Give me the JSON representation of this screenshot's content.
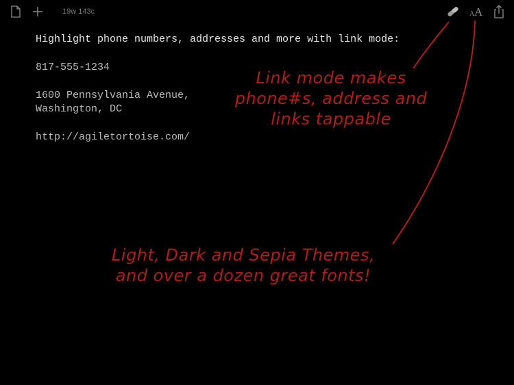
{
  "toolbar": {
    "word_count": "19w 143c",
    "icons": {
      "documents": "document-icon",
      "new": "plus-icon",
      "link_mode": "link-icon",
      "font": "font-size-icon",
      "share": "share-icon"
    },
    "font_label_small": "A",
    "font_label_big": "A"
  },
  "document": {
    "lines": [
      "Highlight phone numbers, addresses and more with link mode:",
      "817-555-1234",
      "1600 Pennsylvania Avenue,",
      "Washington, DC",
      "http://agiletortoise.com/"
    ]
  },
  "annotations": {
    "link_mode": {
      "line1": "Link mode makes",
      "line2": "phone#s, address and",
      "line3": "links tappable"
    },
    "themes": {
      "line1": "Light, Dark and Sepia Themes,",
      "line2": "and over a dozen great fonts!"
    }
  },
  "colors": {
    "background": "#000000",
    "annotation": "#b01d1d",
    "text": "#e8e8e8",
    "icon": "#8a8a8a"
  }
}
